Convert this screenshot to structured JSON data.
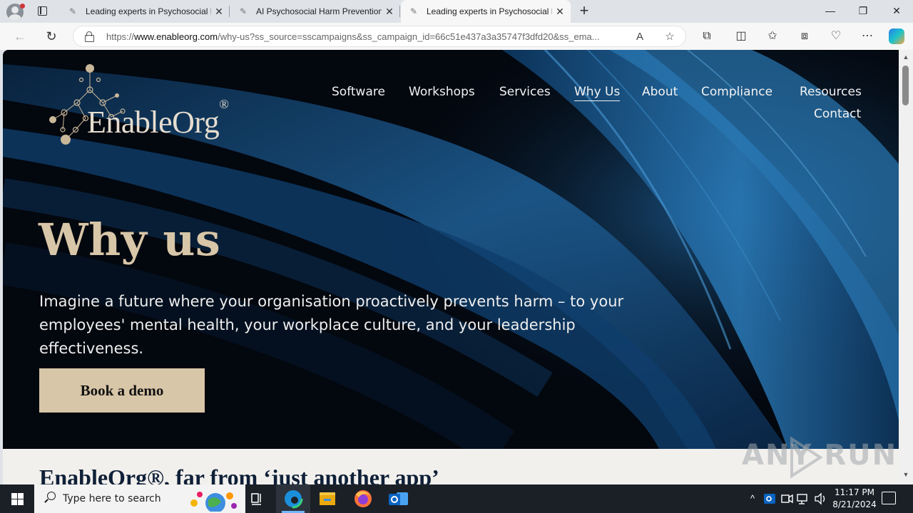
{
  "browser": {
    "tabs": [
      {
        "title": "Leading experts in Psychosocial R",
        "state": "inactive"
      },
      {
        "title": "AI Psychosocial Harm Prevention",
        "state": "inactive"
      },
      {
        "title": "Leading experts in Psychosocial R",
        "state": "active"
      }
    ],
    "url_prefix": "https://",
    "url_host": "www.enableorg.com",
    "url_rest": "/why-us?ss_source=sscampaigns&ss_campaign_id=66c51e437a3a35747f3dfd20&ss_ema..."
  },
  "site": {
    "logo_text": "EnableOrg",
    "logo_mark": "®",
    "nav": [
      "Software",
      "Workshops",
      "Services",
      "Why Us",
      "About",
      "Compliance",
      "Resources",
      "Contact"
    ],
    "current_nav": "Why Us"
  },
  "hero": {
    "title": "Why us",
    "subtitle": "Imagine a future where your organisation proactively prevents harm – to your employees' mental health, your workplace culture, and your leadership effectiveness.",
    "cta_label": "Book a demo"
  },
  "section": {
    "title": "EnableOrg®, far from ‘just another app’"
  },
  "watermark": "ANY RUN",
  "taskbar": {
    "search_placeholder": "Type here to search",
    "time": "11:17 PM",
    "date": "8/21/2024"
  },
  "colors": {
    "hero_bg": "#03070e",
    "accent_gold": "#d8c6a8",
    "silk_blue": "#1e5f96",
    "section_bg": "#f2f0ed"
  }
}
